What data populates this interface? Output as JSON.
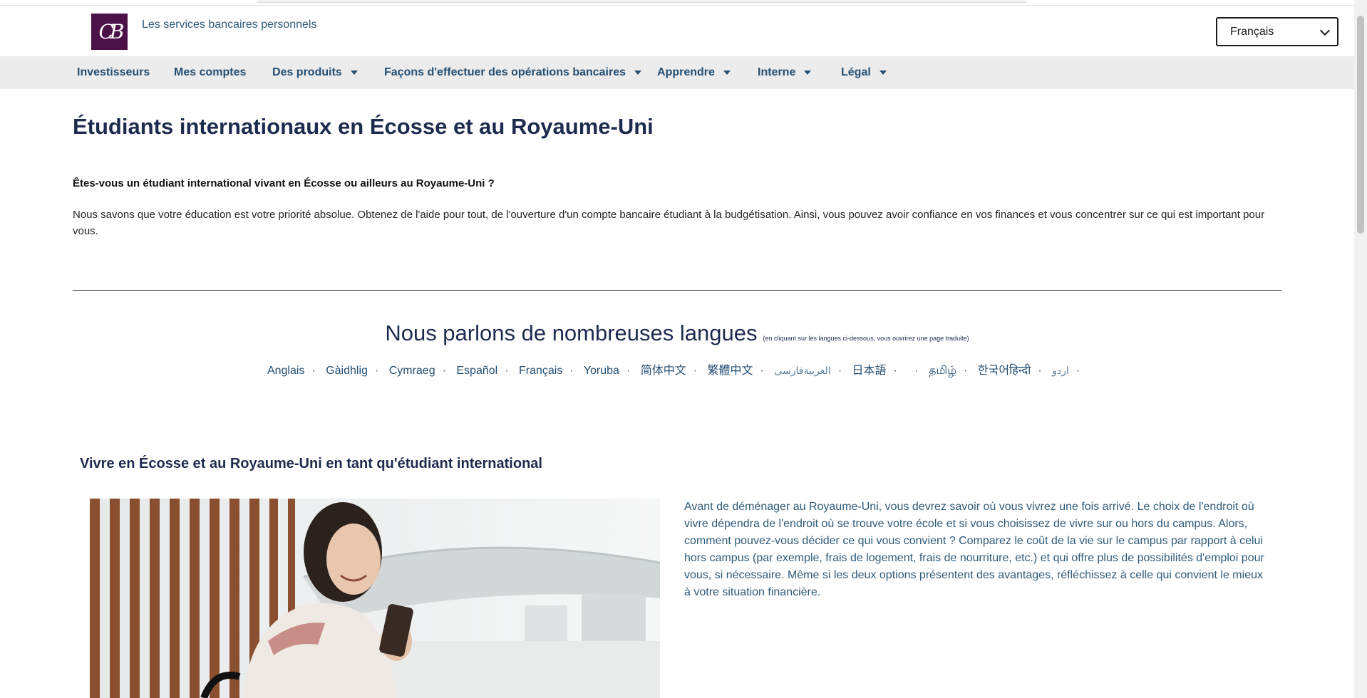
{
  "header": {
    "logo_letters": "CB",
    "tagline": "Les services bancaires personnels",
    "language_selected": "Français"
  },
  "nav": {
    "items": [
      {
        "label": "Investisseurs",
        "has_dropdown": false
      },
      {
        "label": "Mes comptes",
        "has_dropdown": false
      },
      {
        "label": "Des produits",
        "has_dropdown": true
      },
      {
        "label": "Façons d'effectuer des opérations bancaires",
        "has_dropdown": true
      },
      {
        "label": "Apprendre",
        "has_dropdown": true
      },
      {
        "label": "Interne",
        "has_dropdown": true
      },
      {
        "label": "Légal",
        "has_dropdown": true
      }
    ]
  },
  "main": {
    "title": "Étudiants internationaux en Écosse et au Royaume-Uni",
    "question": "Êtes-vous un étudiant international vivant en Écosse ou ailleurs au Royaume-Uni ?",
    "intro": "Nous savons que votre éducation est votre priorité absolue. Obtenez de l'aide pour tout, de l'ouverture d'un compte bancaire étudiant à la budgétisation. Ainsi, vous pouvez avoir confiance en vos finances et vous concentrer sur ce qui est important pour vous."
  },
  "languages": {
    "heading": "Nous parlons de nombreuses langues",
    "note": "(en cliquant sur les langues ci-dessous, vous ouvrirez une page traduite)",
    "items": [
      "Anglais",
      "Gàidhlig",
      "Cymraeg",
      "Español",
      "Français",
      "Yoruba",
      "简体中文",
      "繁體中文",
      "العربيةفارسی",
      "日本語",
      "",
      "தமிழ்",
      "한국어हिन्दी",
      "اردو"
    ],
    "separator": "·"
  },
  "section": {
    "title": "Vivre en Écosse et au Royaume-Uni en tant qu'étudiant international",
    "text": "Avant de déménager au Royaume-Uni, vous devrez savoir où vous vivrez une fois arrivé. Le choix de l'endroit où vivre dépendra de l'endroit où se trouve votre école et si vous choisissez de vivre sur ou hors du campus. Alors, comment pouvez-vous décider ce qui vous convient ? Comparez le coût de la vie sur le campus par rapport à celui hors campus (par exemple, frais de logement, frais de nourriture, etc.) et qui offre plus de possibilités d'emploi pour vous, si nécessaire. Même si les deux options présentent des avantages, réfléchissez à celle qui convient le mieux à votre situation financière.",
    "photo_subject": "student-with-phone-photo"
  },
  "colors": {
    "brand": "#4b1248",
    "nav_text": "#234f74",
    "heading": "#1d2b4f",
    "nav_bg": "#ececec"
  }
}
